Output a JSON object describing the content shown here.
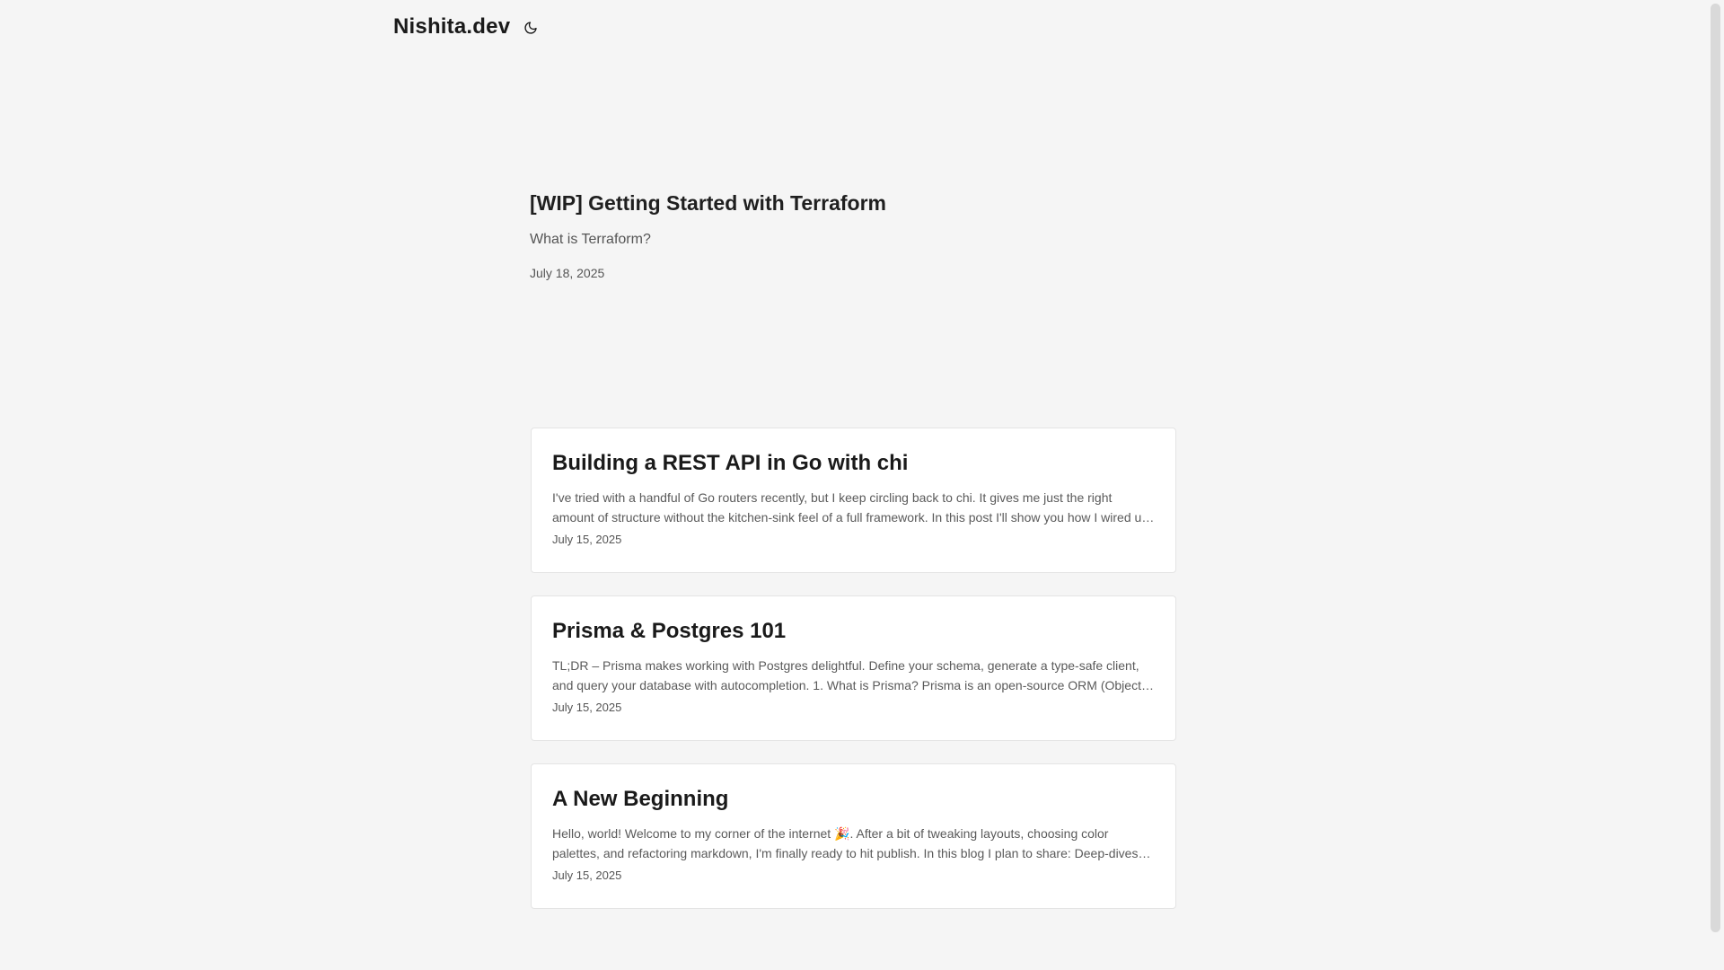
{
  "header": {
    "site_title": "Nishita.dev",
    "theme_toggle_icon": "moon-icon"
  },
  "featured": {
    "title": "[WIP] Getting Started with Terraform",
    "description": "What is Terraform?",
    "date": "July 18, 2025"
  },
  "posts": [
    {
      "title": "Building a REST API in Go with chi",
      "excerpt": "I've tried with a handful of Go routers recently, but I keep circling back to chi. It gives me just the right amount of structure without the kitchen-sink feel of a full framework. In this post I'll show you how I wired up a simple REST API.",
      "date": "July 15, 2025"
    },
    {
      "title": "Prisma & Postgres 101",
      "excerpt": "TL;DR – Prisma makes working with Postgres delightful. Define your schema, generate a type-safe client, and query your database with autocompletion. 1. What is Prisma? Prisma is an open-source ORM (Object-Relational Mapper).",
      "date": "July 15, 2025"
    },
    {
      "title": "A New Beginning",
      "excerpt": "Hello, world! Welcome to my corner of the internet 🎉. After a bit of tweaking layouts, choosing color palettes, and refactoring markdown, I'm finally ready to hit publish. In this blog I plan to share: Deep-dives into the things I build.",
      "date": "July 15, 2025"
    }
  ]
}
